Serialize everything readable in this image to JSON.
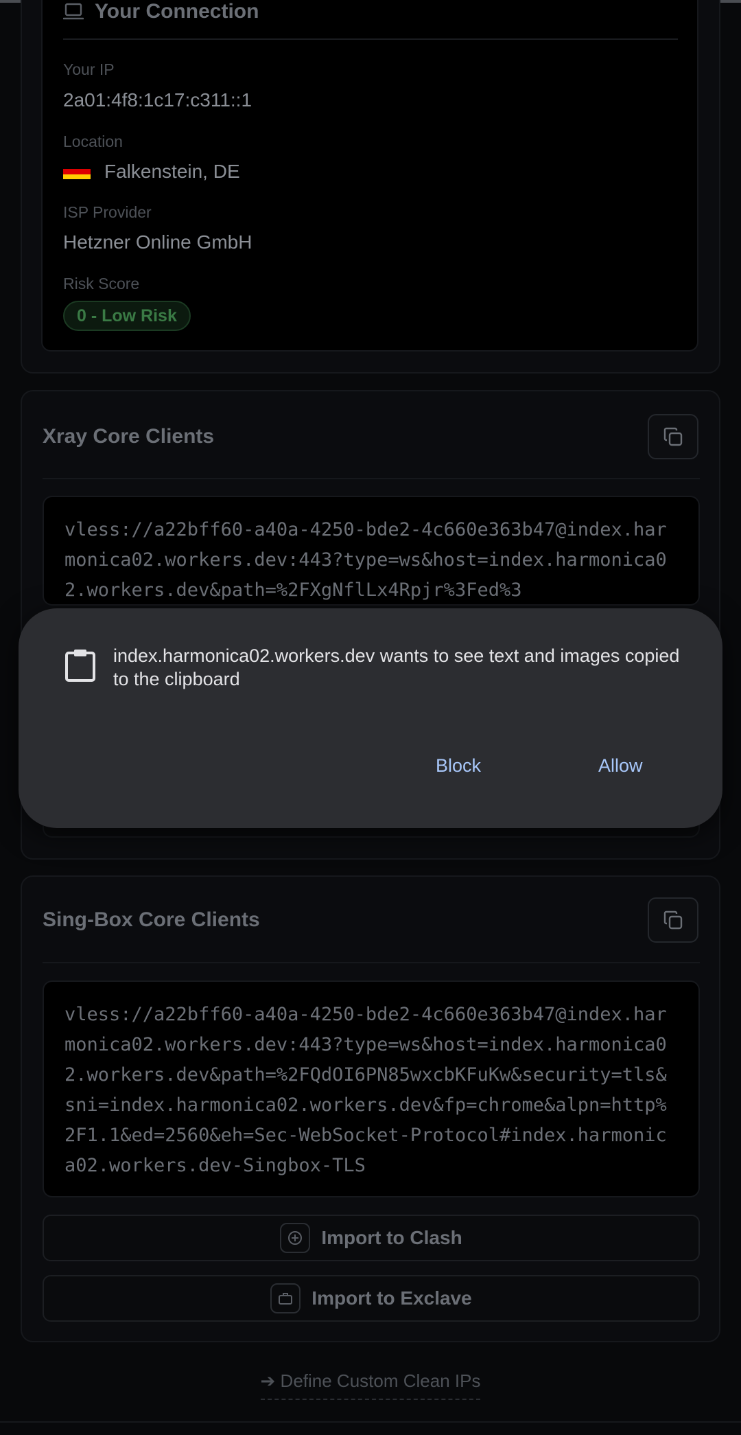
{
  "connection": {
    "title": "Your Connection",
    "ip_label": "Your IP",
    "ip_value": "2a01:4f8:1c17:c311::1",
    "location_label": "Location",
    "location_value": "Falkenstein, DE",
    "isp_label": "ISP Provider",
    "isp_value": "Hetzner Online GmbH",
    "risk_label": "Risk Score",
    "risk_value": "0 - Low Risk",
    "flag_colors": [
      "#000000",
      "#dd0000",
      "#ffce00"
    ]
  },
  "xray": {
    "title": "Xray Core Clients",
    "config": "vless://a22bff60-a40a-4250-bde2-4c660e363b47@index.harmonica02.workers.dev:443?type=ws&host=index.harmonica02.workers.dev&path=%2FXgNflLx4Rpjr%3Fed%3"
  },
  "singbox": {
    "title": "Sing-Box Core Clients",
    "config": "vless://a22bff60-a40a-4250-bde2-4c660e363b47@index.harmonica02.workers.dev:443?type=ws&host=index.harmonica02.workers.dev&path=%2FQdOI6PN85wxcbKFuKw&security=tls&sni=index.harmonica02.workers.dev&fp=chrome&alpn=http%2F1.1&ed=2560&eh=Sec-WebSocket-Protocol#index.harmonica02.workers.dev-Singbox-TLS",
    "import_clash": "Import to Clash",
    "import_exclave": "Import to Exclave"
  },
  "footer": {
    "define_ips": "➔ Define Custom Clean IPs"
  },
  "dialog": {
    "message": "index.harmonica02.workers.dev wants to see text and images copied to the clipboard",
    "block_label": "Block",
    "allow_label": "Allow",
    "link_color": "#a8c7fa"
  }
}
